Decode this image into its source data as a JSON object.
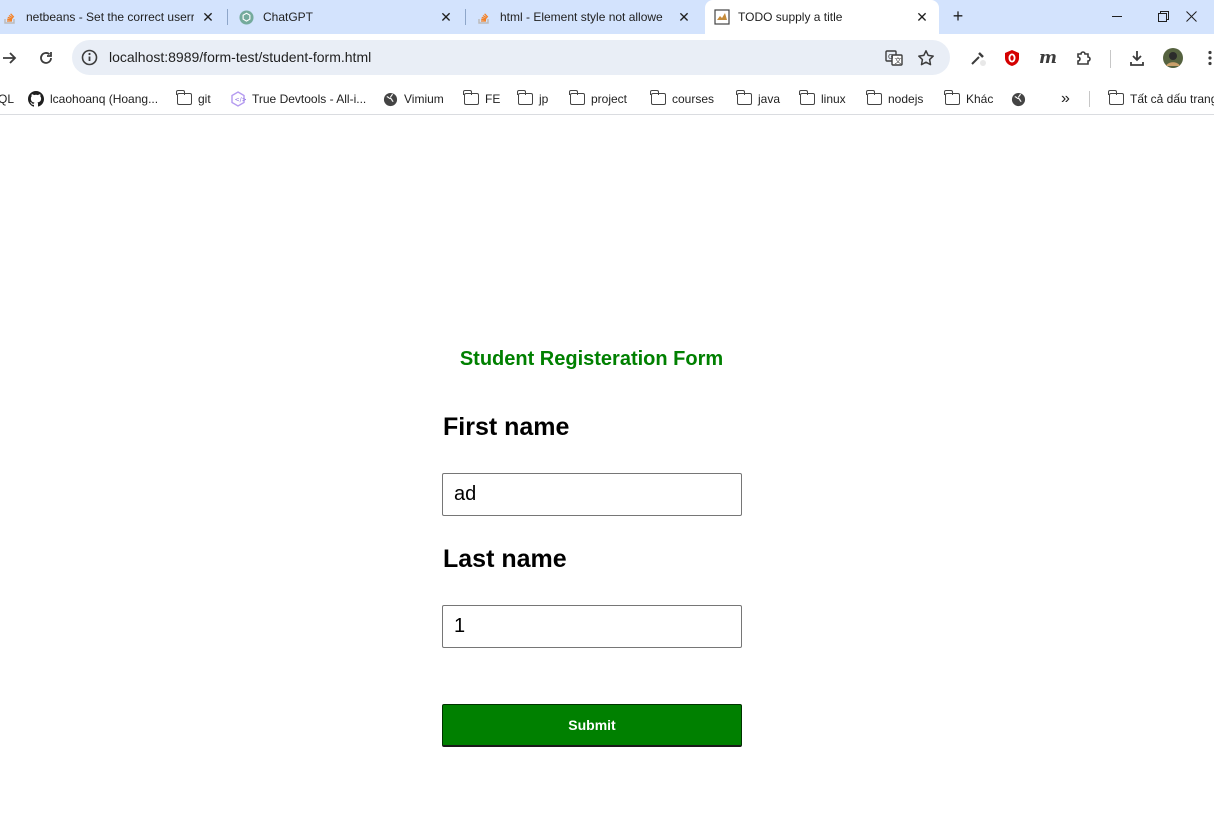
{
  "browser": {
    "tabs": [
      {
        "title": "netbeans - Set the correct userr",
        "favicon": "stackoverflow-icon",
        "active": false
      },
      {
        "title": "ChatGPT",
        "favicon": "chatgpt-icon",
        "active": false
      },
      {
        "title": "html - Element style not allowe",
        "favicon": "stackoverflow-icon",
        "active": false
      },
      {
        "title": "TODO supply a title",
        "favicon": "page-icon",
        "active": true
      }
    ],
    "new_tab": "+",
    "url": "localhost:8989/form-test/student-form.html",
    "bookmarks": [
      {
        "label": "QL",
        "icon": "none"
      },
      {
        "label": "lcaohoanq (Hoang...",
        "icon": "github-icon"
      },
      {
        "label": "git",
        "icon": "folder-icon"
      },
      {
        "label": "True Devtools - All-i...",
        "icon": "devtools-icon"
      },
      {
        "label": "Vimium",
        "icon": "globe-icon"
      },
      {
        "label": "FE",
        "icon": "folder-icon"
      },
      {
        "label": "jp",
        "icon": "folder-icon"
      },
      {
        "label": "project",
        "icon": "folder-icon"
      },
      {
        "label": "courses",
        "icon": "folder-icon"
      },
      {
        "label": "java",
        "icon": "folder-icon"
      },
      {
        "label": "linux",
        "icon": "folder-icon"
      },
      {
        "label": "nodejs",
        "icon": "folder-icon"
      },
      {
        "label": "Khác",
        "icon": "folder-icon"
      },
      {
        "label": "",
        "icon": "globe-icon"
      },
      {
        "label": "Tất cả dấu trang",
        "icon": "folder-icon"
      }
    ],
    "overflow_chevron": "»"
  },
  "form": {
    "title": "Student Registeration Form",
    "first_name_label": "First name",
    "first_name_value": "ad",
    "last_name_label": "Last name",
    "last_name_value": "1",
    "submit_label": "Submit"
  },
  "colors": {
    "accent": "#008000",
    "tabstrip": "#d3e3fd"
  }
}
